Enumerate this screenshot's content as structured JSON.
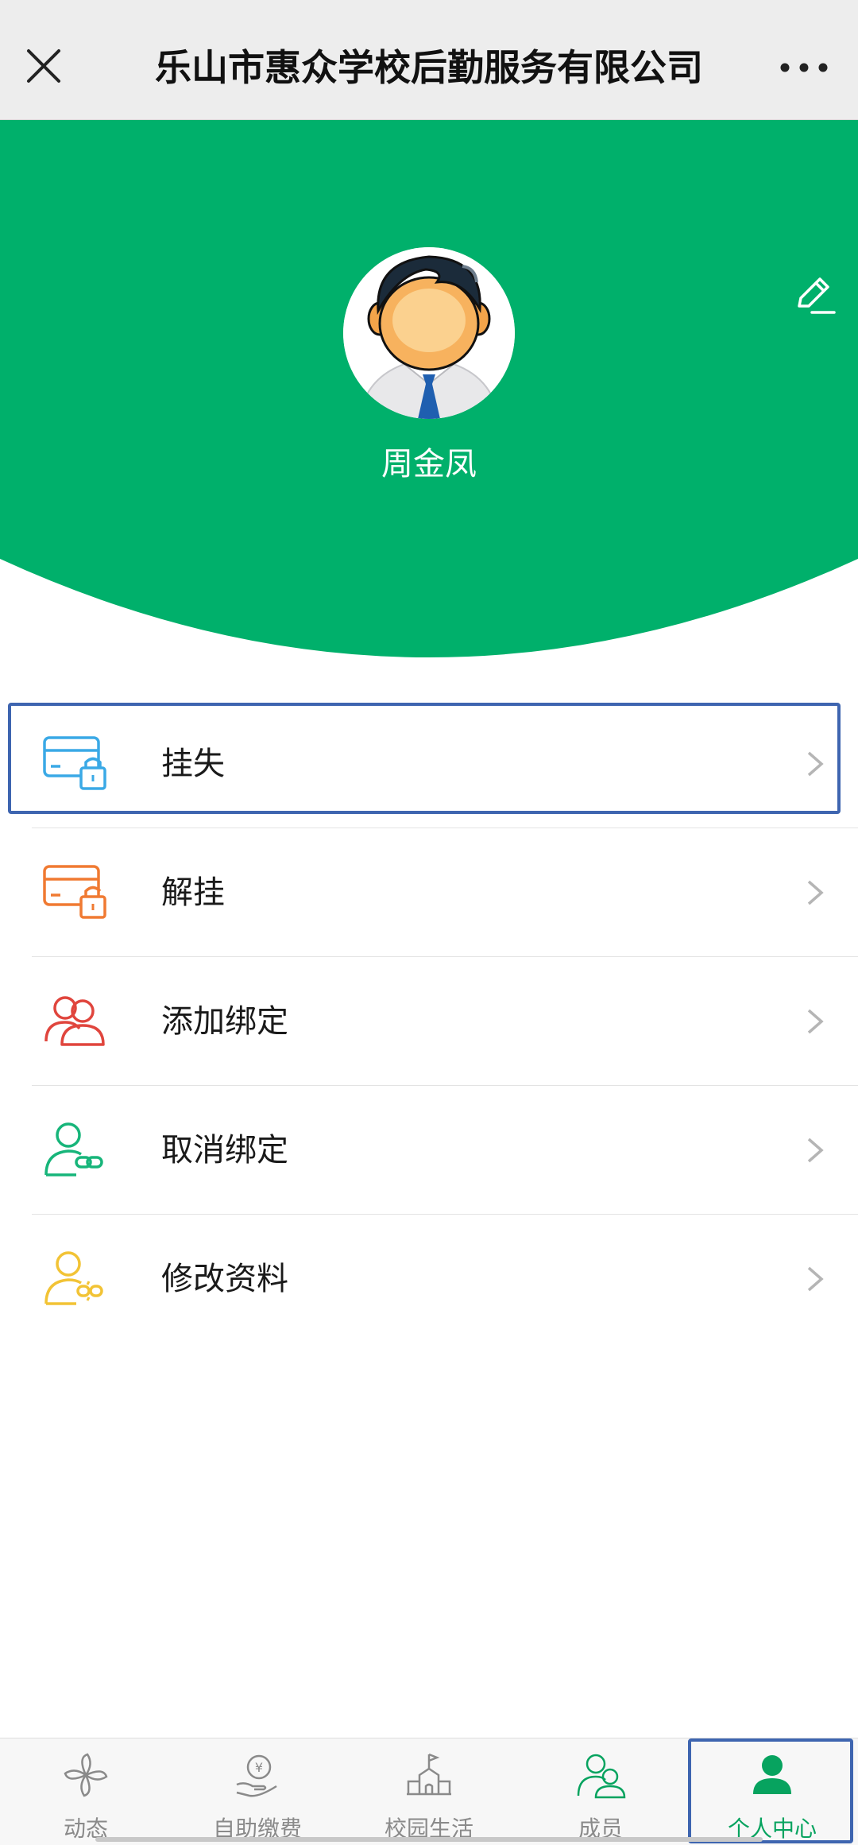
{
  "header": {
    "title": "乐山市惠众学校后勤服务有限公司"
  },
  "profile": {
    "name": "周金凤"
  },
  "menu": {
    "items": [
      {
        "label": "挂失",
        "icon": "card-lock-icon",
        "color": "#3aa9e6"
      },
      {
        "label": "解挂",
        "icon": "card-unlock-icon",
        "color": "#f07a32"
      },
      {
        "label": "添加绑定",
        "icon": "users-icon",
        "color": "#e0453d"
      },
      {
        "label": "取消绑定",
        "icon": "user-link-icon",
        "color": "#17b57a"
      },
      {
        "label": "修改资料",
        "icon": "user-edit-icon",
        "color": "#f2c335"
      }
    ]
  },
  "tabbar": {
    "tabs": [
      {
        "label": "动态",
        "icon": "pinwheel-icon"
      },
      {
        "label": "自助缴费",
        "icon": "payment-hand-icon"
      },
      {
        "label": "校园生活",
        "icon": "campus-building-icon"
      },
      {
        "label": "成员",
        "icon": "members-icon"
      },
      {
        "label": "个人中心",
        "icon": "person-icon"
      }
    ],
    "active_index": 4
  },
  "colors": {
    "brand": "#00b06b",
    "active_tab": "#07a35f",
    "highlight": "#3e65b0"
  }
}
